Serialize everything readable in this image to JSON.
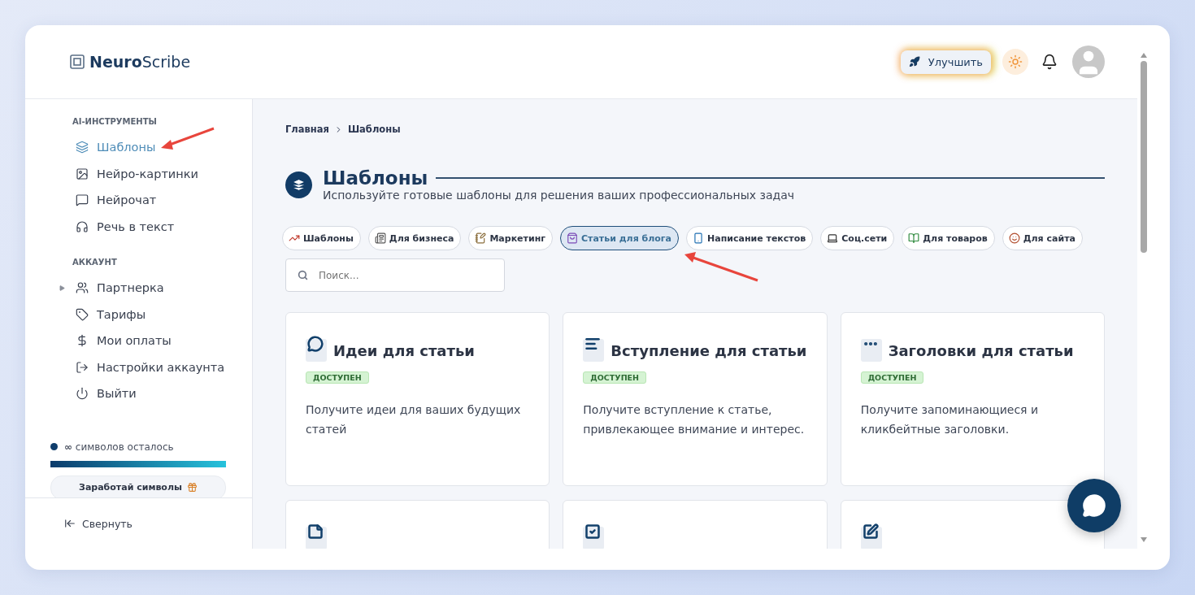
{
  "brand": {
    "name_bold": "Neuro",
    "name_light": "Scribe"
  },
  "header": {
    "upgrade_label": "Улучшить"
  },
  "sidebar": {
    "sections": [
      {
        "heading": "AI-ИНСТРУМЕНТЫ",
        "items": [
          {
            "label": "Шаблоны",
            "selected": true,
            "expandable": false
          },
          {
            "label": "Нейро-картинки",
            "selected": false,
            "expandable": false
          },
          {
            "label": "Нейрочат",
            "selected": false,
            "expandable": false
          },
          {
            "label": "Речь в текст",
            "selected": false,
            "expandable": false
          }
        ]
      },
      {
        "heading": "АККАУНТ",
        "items": [
          {
            "label": "Партнерка",
            "selected": false,
            "expandable": true
          },
          {
            "label": "Тарифы",
            "selected": false,
            "expandable": false
          },
          {
            "label": "Мои оплаты",
            "selected": false,
            "expandable": false
          },
          {
            "label": "Настройки аккаунта",
            "selected": false,
            "expandable": false
          },
          {
            "label": "Выйти",
            "selected": false,
            "expandable": false
          }
        ]
      }
    ],
    "credits": {
      "amount": "∞",
      "text": "символов осталось",
      "level": 1
    },
    "earn_button": "Заработай символы",
    "collapse": "Свернуть"
  },
  "main": {
    "breadcrumb": [
      "Главная",
      "Шаблоны"
    ],
    "title": "Шаблоны",
    "subtitle": "Используйте готовые шаблоны для решения ваших профессиональных задач",
    "chips": [
      {
        "label": "Шаблоны",
        "selected": false
      },
      {
        "label": "Для бизнеса",
        "selected": false
      },
      {
        "label": "Маркетинг",
        "selected": false
      },
      {
        "label": "Статьи для блога",
        "selected": true
      },
      {
        "label": "Написание текстов",
        "selected": false
      },
      {
        "label": "Соц.сети",
        "selected": false
      },
      {
        "label": "Для товаров",
        "selected": false
      },
      {
        "label": "Для сайта",
        "selected": false
      }
    ],
    "search": {
      "placeholder": "Поиск..."
    },
    "cards": [
      {
        "title": "Идеи для статьи",
        "badge": "ДОСТУПЕН",
        "description": "Получите идеи для ваших будущих статей"
      },
      {
        "title": "Вступление для статьи",
        "badge": "ДОСТУПЕН",
        "description": "Получите вступление к статье, привлекающее внимание и интерес."
      },
      {
        "title": "Заголовки для статьи",
        "badge": "ДОСТУПЕН",
        "description": "Получите запоминающиеся и кликбейтные заголовки."
      }
    ]
  }
}
